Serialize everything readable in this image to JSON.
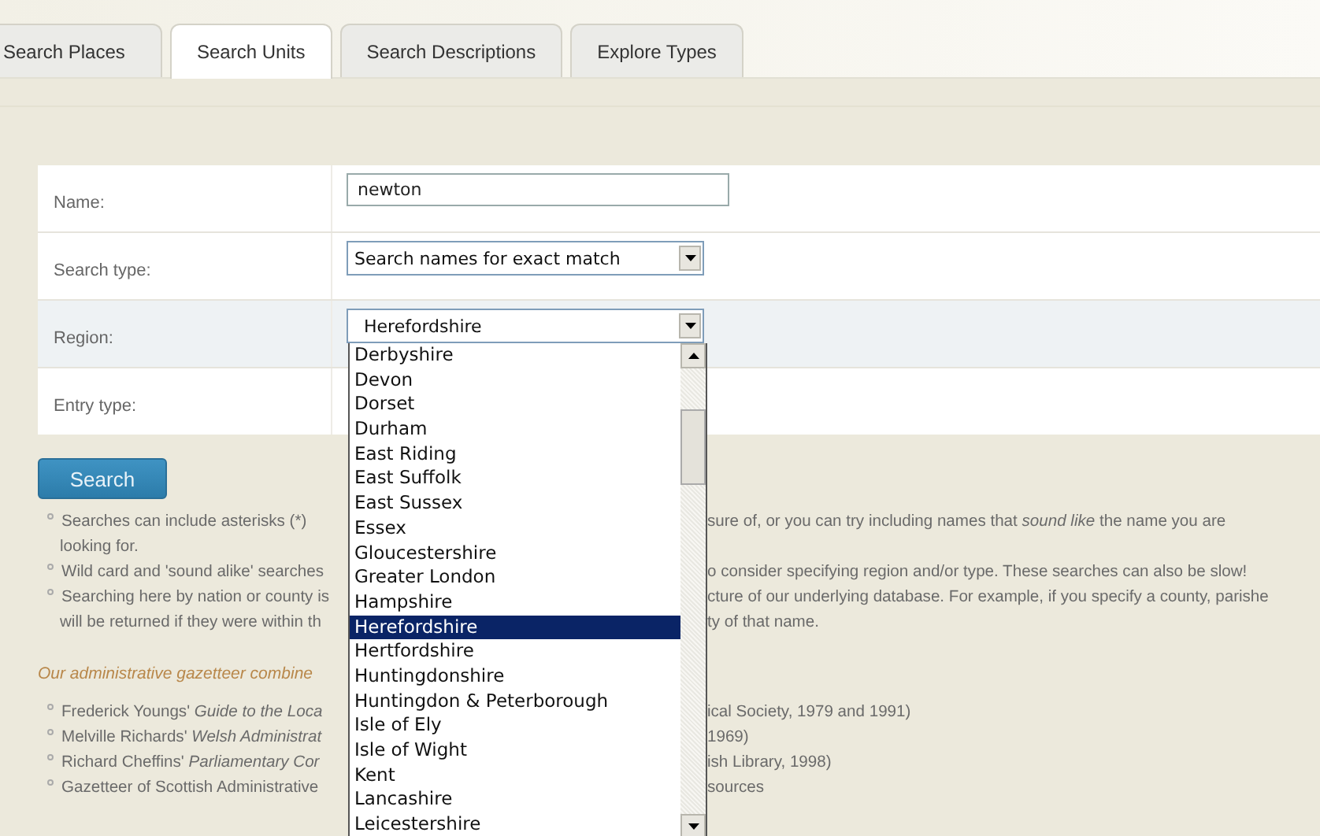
{
  "tabs": [
    {
      "label": "Search Places",
      "selected": false
    },
    {
      "label": "Search Units",
      "selected": true
    },
    {
      "label": "Search Descriptions",
      "selected": false
    },
    {
      "label": "Explore Types",
      "selected": false
    }
  ],
  "form": {
    "fields": [
      {
        "kind": "text",
        "label": "Name:",
        "value": "newton",
        "highlighted": false
      },
      {
        "kind": "select",
        "label": "Search type:",
        "value": "Search names for exact match",
        "highlighted": false
      },
      {
        "kind": "select",
        "label": "Region:",
        "value": "Herefordshire",
        "highlighted": true,
        "expanded": true,
        "options": [
          {
            "label": "Derbyshire",
            "selected": false
          },
          {
            "label": "Devon",
            "selected": false
          },
          {
            "label": "Dorset",
            "selected": false
          },
          {
            "label": "Durham",
            "selected": false
          },
          {
            "label": "East Riding",
            "selected": false
          },
          {
            "label": "East Suffolk",
            "selected": false
          },
          {
            "label": "East Sussex",
            "selected": false
          },
          {
            "label": "Essex",
            "selected": false
          },
          {
            "label": "Gloucestershire",
            "selected": false
          },
          {
            "label": "Greater London",
            "selected": false
          },
          {
            "label": "Hampshire",
            "selected": false
          },
          {
            "label": "Herefordshire",
            "selected": true
          },
          {
            "label": "Hertfordshire",
            "selected": false
          },
          {
            "label": "Huntingdonshire",
            "selected": false
          },
          {
            "label": "Huntingdon & Peterborough",
            "selected": false
          },
          {
            "label": "Isle of Ely",
            "selected": false
          },
          {
            "label": "Isle of Wight",
            "selected": false
          },
          {
            "label": "Kent",
            "selected": false
          },
          {
            "label": "Lancashire",
            "selected": false
          },
          {
            "label": "Leicestershire",
            "selected": false
          }
        ]
      },
      {
        "kind": "empty",
        "label": "Entry type:",
        "highlighted": false
      }
    ]
  },
  "search_button": "Search",
  "notes": [
    {
      "bullet": true,
      "left": "Searches can include asterisks (*)",
      "right": "sure of, or you can try including names that *sound like* the name you are"
    },
    {
      "bullet": false,
      "left": "looking for."
    },
    {
      "bullet": true,
      "left": "Wild card and 'sound alike' searches",
      "right": "o consider specifying region and/or type. These searches can also be slow!"
    },
    {
      "bullet": true,
      "left": "Searching here by nation or county is",
      "right": "cture of our underlying database. For example, if you specify a county, parishe"
    },
    {
      "bullet": false,
      "left": "will be returned if they were within th",
      "right": "ty of that name."
    }
  ],
  "sources_heading": "Our administrative gazetteer combine",
  "sources": [
    {
      "bullet": true,
      "left": "Frederick Youngs' *Guide to the Loca*",
      "right": "ical Society, 1979 and 1991)"
    },
    {
      "bullet": true,
      "left": "Melville Richards' *Welsh Administrat*",
      "right": "1969)"
    },
    {
      "bullet": true,
      "left": "Richard Cheffins' *Parliamentary Cor*",
      "right": "ish Library, 1998)"
    },
    {
      "bullet": true,
      "left": "Gazetteer of Scottish Administrative",
      "right": "sources"
    }
  ]
}
